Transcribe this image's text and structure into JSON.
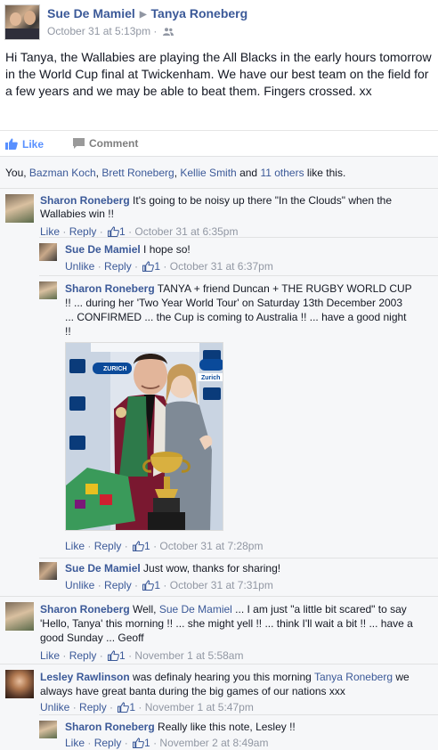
{
  "post": {
    "author": "Sue De Mamiel",
    "target": "Tanya Roneberg",
    "timestamp": "October 31 at 5:13pm",
    "meta_sep": "·",
    "text": "Hi Tanya, the Wallabies are playing the All Blacks in the early hours tomorrow in the World Cup final at Twickenham. We have our best team on the field for a few years and we may be able to beat them. Fingers crossed. xx"
  },
  "actions": {
    "like_label": "Like",
    "comment_label": "Comment"
  },
  "likes": {
    "prefix": "You, ",
    "names": [
      "Bazman Koch",
      "Brett Roneberg",
      "Kellie Smith"
    ],
    "and": " and ",
    "others": "11 others",
    "suffix": " like this."
  },
  "comments": [
    {
      "author": "Sharon Roneberg",
      "text": " It's going to be noisy up there \"In the Clouds\" when the Wallabies win !!",
      "like_label": "Like",
      "reply_label": "Reply",
      "likes": "1",
      "time": "October 31 at 6:35pm"
    },
    {
      "author": "Sue De Mamiel",
      "text": " I hope so!",
      "like_label": "Unlike",
      "reply_label": "Reply",
      "likes": "1",
      "time": "October 31 at 6:37pm"
    },
    {
      "author": "Sharon Roneberg",
      "text": " TANYA + friend Duncan + THE RUGBY WORLD CUP !! ... during her 'Two Year World Tour' on Saturday 13th December 2003 ... CONFIRMED ... the Cup is coming to Australia !! ... have a good night !!",
      "like_label": "Like",
      "reply_label": "Reply",
      "likes": "1",
      "time": "October 31 at 7:28pm"
    },
    {
      "author": "Sue De Mamiel",
      "text": " Just wow, thanks for sharing!",
      "like_label": "Unlike",
      "reply_label": "Reply",
      "likes": "1",
      "time": "October 31 at 7:31pm"
    },
    {
      "author": "Sharon Roneberg",
      "text_before": " Well, ",
      "mention": "Sue De Mamiel",
      "text_after": " ... I am just \"a little bit scared\" to say 'Hello, Tanya' this morning !! ... she might yell !! ... think I'll wait a bit !! ... have a good Sunday ... Geoff",
      "like_label": "Like",
      "reply_label": "Reply",
      "likes": "1",
      "time": "November 1 at 5:58am"
    },
    {
      "author": "Lesley Rawlinson",
      "text_before": " was definaly hearing you this morning ",
      "mention": "Tanya Roneberg",
      "text_after": " we always have great banta during the big games of our nations xxx",
      "like_label": "Unlike",
      "reply_label": "Reply",
      "likes": "1",
      "time": "November 1 at 5:47pm"
    },
    {
      "author": "Sharon Roneberg",
      "text": " Really like this note, Lesley !!",
      "like_label": "Like",
      "reply_label": "Reply",
      "likes": "1",
      "time": "November 2 at 8:49am"
    }
  ],
  "photo_banner": {
    "brand": "ZURICH",
    "sponsor": "Zurich"
  },
  "colors": {
    "link": "#3b5998",
    "meta": "#9197a3",
    "like_active": "#5890ff",
    "ufi_bg": "#f6f7f9"
  }
}
